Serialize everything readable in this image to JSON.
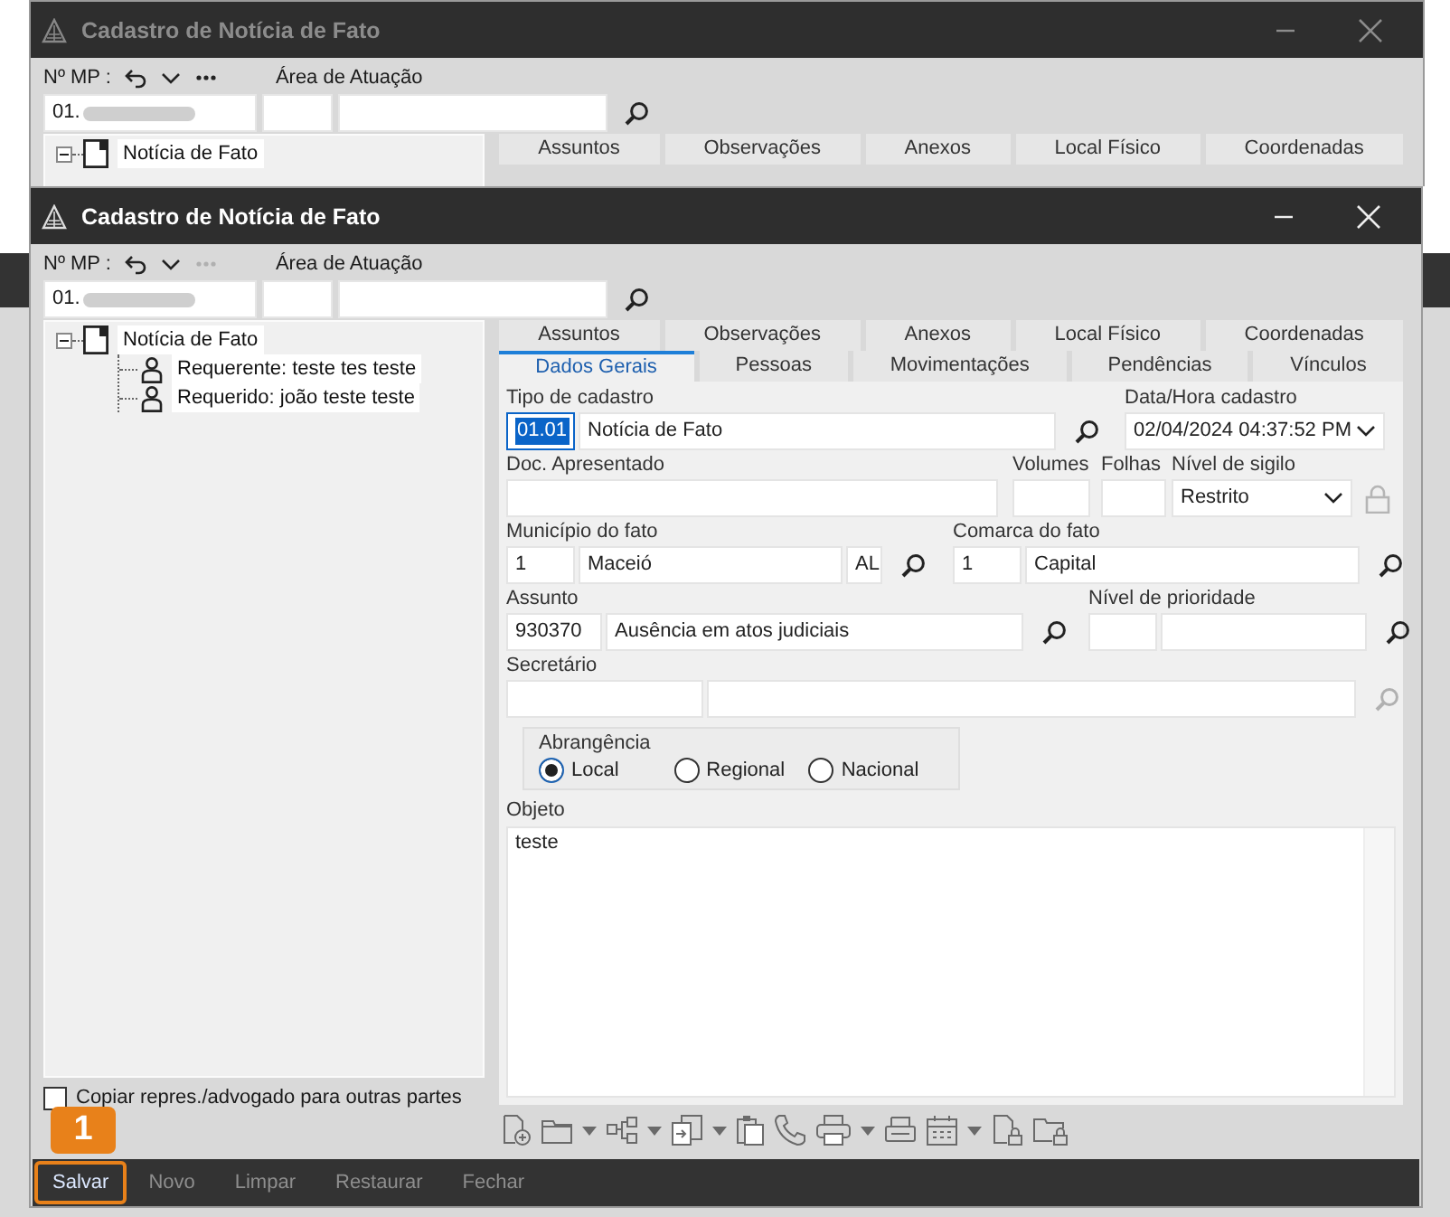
{
  "background_windows": [
    {
      "title": "Cadastro de Notícia de Fato",
      "active": false,
      "mp_label": "Nº MP :",
      "more_enabled": true,
      "area_label": "Área de Atuação",
      "mp_value": "01.",
      "tree": [
        {
          "label": "Notícia de Fato",
          "kind": "document",
          "expanded": true
        }
      ],
      "tabs_row_1": [
        {
          "label": "Assuntos",
          "selected": false
        },
        {
          "label": "Observações",
          "selected": false
        },
        {
          "label": "Anexos",
          "selected": false
        },
        {
          "label": "Local Físico",
          "selected": false
        },
        {
          "label": "Coordenadas",
          "selected": false
        }
      ]
    }
  ],
  "window": {
    "title": "Cadastro de Notícia de Fato",
    "active": true,
    "mp_label": "Nº MP :",
    "more_enabled": false,
    "area_label": "Área de Atuação",
    "mp_value": "01.",
    "tree": [
      {
        "label": "Notícia de Fato",
        "kind": "document",
        "expanded": true,
        "children": [
          {
            "label": "Requerente: teste tes teste",
            "kind": "person"
          },
          {
            "label": "Requerido: joão teste teste",
            "kind": "person"
          }
        ]
      }
    ],
    "tabs_row_1": [
      {
        "label": "Assuntos",
        "selected": false
      },
      {
        "label": "Observações",
        "selected": false
      },
      {
        "label": "Anexos",
        "selected": false
      },
      {
        "label": "Local Físico",
        "selected": false
      },
      {
        "label": "Coordenadas",
        "selected": false
      }
    ],
    "tabs_row_2": [
      {
        "label": "Dados Gerais",
        "selected": true
      },
      {
        "label": "Pessoas",
        "selected": false
      },
      {
        "label": "Movimentações",
        "selected": false
      },
      {
        "label": "Pendências",
        "selected": false
      },
      {
        "label": "Vínculos",
        "selected": false
      }
    ],
    "form": {
      "tipo_de_cadastro": {
        "label": "Tipo de cadastro",
        "code": "01.01",
        "code_highlighted": true,
        "name": "Notícia de Fato"
      },
      "data_hora_cadastro": {
        "label": "Data/Hora cadastro",
        "value": "02/04/2024 04:37:52 PM"
      },
      "doc_apresentado": {
        "label": "Doc. Apresentado"
      },
      "volumes": {
        "label": "Volumes"
      },
      "folhas": {
        "label": "Folhas"
      },
      "nivel_de_sigilo": {
        "label": "Nível de sigilo",
        "value": "Restrito"
      },
      "municipio_do_fato": {
        "label": "Município do fato",
        "code": "1",
        "name": "Maceió",
        "uf": "AL"
      },
      "comarca_do_fato": {
        "label": "Comarca do fato",
        "code": "1",
        "name": "Capital"
      },
      "assunto": {
        "label": "Assunto",
        "code": "930370",
        "name": "Ausência em atos judiciais"
      },
      "nivel_de_prioridade": {
        "label": "Nível de prioridade"
      },
      "secretario": {
        "label": "Secretário",
        "disabled": true
      },
      "abrangencia": {
        "label": "Abrangência",
        "options": [
          {
            "label": "Local",
            "selected": true
          },
          {
            "label": "Regional",
            "selected": false
          },
          {
            "label": "Nacional",
            "selected": false
          }
        ]
      },
      "objeto": {
        "label": "Objeto",
        "value": "teste"
      }
    },
    "copy_checkbox": {
      "label": "Copiar repres./advogado para outras partes",
      "checked": false
    },
    "buttons": [
      {
        "label": "Salvar",
        "disabled": false,
        "highlighted": true
      },
      {
        "label": "Novo",
        "disabled": true,
        "highlighted": false
      },
      {
        "label": "Limpar",
        "disabled": true,
        "highlighted": false
      },
      {
        "label": "Restaurar",
        "disabled": true,
        "highlighted": false
      },
      {
        "label": "Fechar",
        "disabled": true,
        "highlighted": false
      }
    ],
    "callout": {
      "number": "1"
    }
  }
}
